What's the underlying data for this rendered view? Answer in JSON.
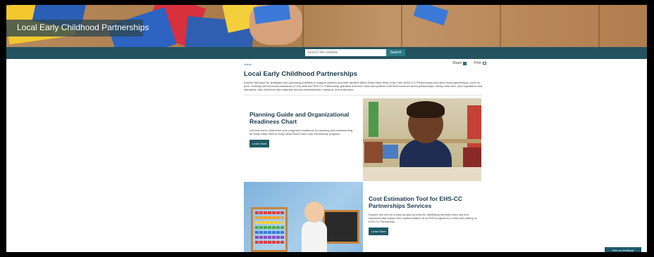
{
  "hero": {
    "title": "Local Early Childhood Partnerships"
  },
  "search": {
    "placeholder": "Search this website",
    "button": "Search"
  },
  "breadcrumb": "Home",
  "tools": {
    "share": "Share",
    "print": "Print"
  },
  "page": {
    "title": "Local Early Childhood Partnerships",
    "intro": "Explore this topic for strategies and promising practices to support children and their families within Early Head Start-Child Care (EHS-CC) Partnerships and other local partnerships, such as prek. Training and technical assistance (T/TA) staff and EHS-CC Partnership grantees and their child care partners will find resources about partnerships, family child care, and regulations and standards. Also find tools and materials around administration, research, and evaluation."
  },
  "cards": [
    {
      "title": "Planning Guide and Organizational Readiness Chart",
      "body": "Use this tool to determine your program's readiness for planning and implementing an Early Head Start or Early Head Start-Child Care Partnership program.",
      "button": "Learn More"
    },
    {
      "title": "Cost Estimation Tool for EHS-CC Partnerships Services",
      "body": "Explore this tool for a step-by-step process for identifying relevant costs and find resources that support the implementation of an EHS program in a child care setting or EHS-CC Partnership.",
      "button": "Learn More"
    }
  ],
  "feedback": "Give us feedback",
  "colors": {
    "search_band": "#22535e",
    "button": "#1e5a68",
    "heading": "#1b3b4c"
  }
}
